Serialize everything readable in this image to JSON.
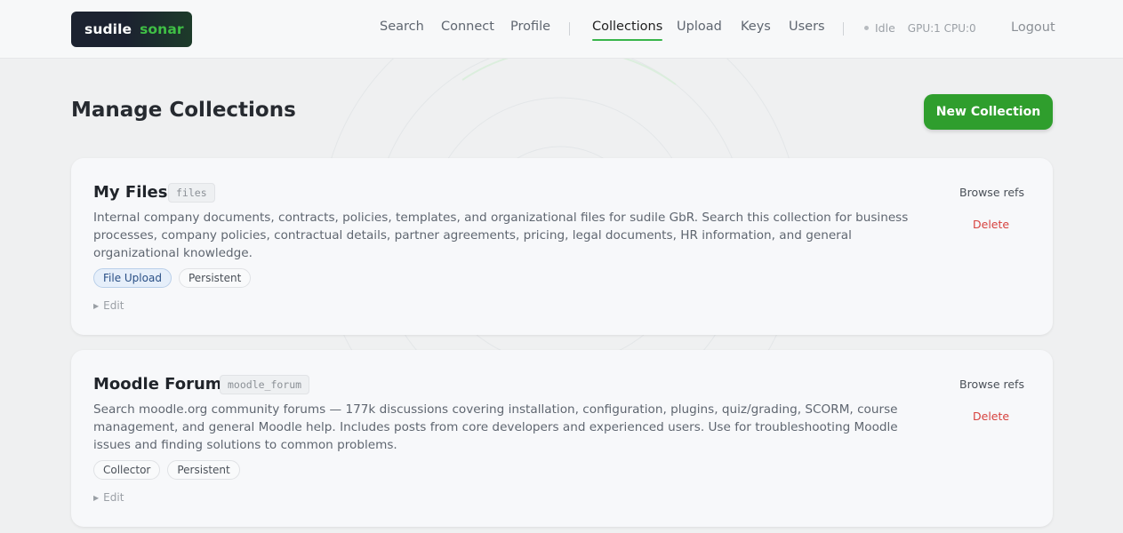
{
  "brand": {
    "part1": "sudile",
    "part2": "sonar"
  },
  "nav": {
    "items": [
      "Search",
      "Connect",
      "Profile",
      "Collections",
      "Upload",
      "Keys",
      "Users"
    ],
    "active": "Collections",
    "status": "Idle",
    "resources": "GPU:1 CPU:0",
    "logout": "Logout"
  },
  "page": {
    "title": "Manage Collections",
    "new_button": "New Collection"
  },
  "collections": [
    {
      "name": "My Files",
      "slug": "files",
      "description": "Internal company documents, contracts, policies, templates, and organizational files for sudile GbR. Search this collection for business processes, company policies, contractual details, partner agreements, pricing, legal documents, HR information, and general organizational knowledge.",
      "tags": [
        "File Upload",
        "Persistent"
      ],
      "edit": "Edit",
      "browse": "Browse refs",
      "delete": "Delete"
    },
    {
      "name": "Moodle Forum",
      "slug": "moodle_forum",
      "description": "Search moodle.org community forums — 177k discussions covering installation, configuration, plugins, quiz/grading, SCORM, course management, and general Moodle help. Includes posts from core developers and experienced users. Use for troubleshooting Moodle issues and finding solutions to common problems.",
      "tags": [
        "Collector",
        "Persistent"
      ],
      "edit": "Edit",
      "browse": "Browse refs",
      "delete": "Delete"
    }
  ],
  "colors": {
    "accent": "#38b54a",
    "primary_button": "#2f9e2d",
    "danger": "#d7423e",
    "tag_blue": "#294f85"
  }
}
